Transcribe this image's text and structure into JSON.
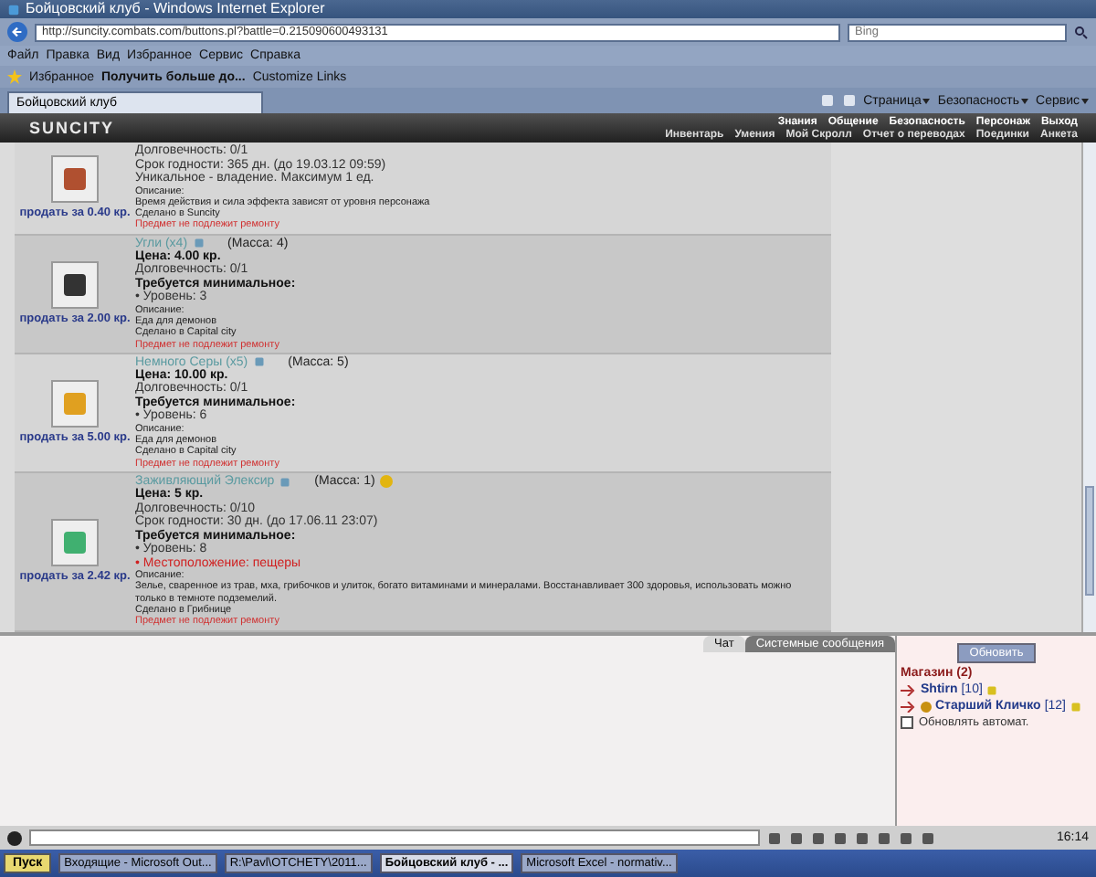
{
  "window": {
    "title": "Бойцовский клуб - Windows Internet Explorer"
  },
  "address_bar": {
    "url": "http://suncity.combats.com/buttons.pl?battle=0.215090600493131",
    "search_placeholder": "Bing"
  },
  "menu": [
    "Файл",
    "Правка",
    "Вид",
    "Избранное",
    "Сервис",
    "Справка"
  ],
  "favorites_bar": {
    "favorites": "Избранное",
    "links": [
      "Получить больше до...",
      "Customize Links"
    ]
  },
  "tabs": [
    {
      "label": "Бойцовский клуб",
      "selected": true
    }
  ],
  "command_bar": [
    "Страница",
    "Безопасность",
    "Сервис"
  ],
  "game": {
    "logo": "SUNCITY",
    "top_nav": [
      "Знания",
      "Общение",
      "Безопасность",
      "Персонаж",
      "Выход"
    ],
    "sub_nav": [
      "Инвентарь",
      "Умения",
      "Мой Скролл",
      "Отчет о переводах",
      "Поединки",
      "Анкета"
    ]
  },
  "items": [
    {
      "sell": "продать за 0.40 кр.",
      "marked": false,
      "lines": [
        {
          "kind": "info",
          "text": "Долговечность: 0/1"
        },
        {
          "kind": "info",
          "text": "Срок годности: 365 дн. (до 19.03.12 09:59)"
        },
        {
          "kind": "info",
          "text": "Уникальное - владение. Максимум 1 ед."
        },
        {
          "kind": "small",
          "text": "Описание:"
        },
        {
          "kind": "small",
          "text": "Время действия и сила эффекта зависят от уровня персонажа"
        },
        {
          "kind": "small",
          "text": "Сделано в Suncity"
        },
        {
          "kind": "warning",
          "text": "Предмет не подлежит ремонту"
        }
      ]
    },
    {
      "name": "Угли (x4)",
      "mass": "(Масса: 4)",
      "sell": "продать за 2.00 кр.",
      "marked": false,
      "lines": [
        {
          "kind": "price",
          "text": "Цена: 4.00 кр."
        },
        {
          "kind": "info",
          "text": "Долговечность: 0/1"
        },
        {
          "kind": "heading",
          "text": "Требуется минимальное:"
        },
        {
          "kind": "info",
          "text": "• Уровень: 3"
        },
        {
          "kind": "small",
          "text": "Описание:"
        },
        {
          "kind": "small",
          "text": "Еда для демонов"
        },
        {
          "kind": "small",
          "text": "Сделано в Capital city"
        },
        {
          "kind": "warning",
          "text": "Предмет не подлежит ремонту"
        }
      ]
    },
    {
      "name": "Немного Серы (x5)",
      "mass": "(Масса: 5)",
      "sell": "продать за 5.00 кр.",
      "marked": false,
      "lines": [
        {
          "kind": "price",
          "text": "Цена: 10.00 кр."
        },
        {
          "kind": "info",
          "text": "Долговечность: 0/1"
        },
        {
          "kind": "heading",
          "text": "Требуется минимальное:"
        },
        {
          "kind": "info",
          "text": "• Уровень: 6"
        },
        {
          "kind": "small",
          "text": "Описание:"
        },
        {
          "kind": "small",
          "text": "Еда для демонов"
        },
        {
          "kind": "small",
          "text": "Сделано в Capital city"
        },
        {
          "kind": "warning",
          "text": "Предмет не подлежит ремонту"
        }
      ]
    },
    {
      "name": "Заживляющий Элексир",
      "mass": "(Масса: 1)",
      "sell": "продать за 2.42 кр.",
      "marked": true,
      "lines": [
        {
          "kind": "price",
          "text": "Цена: 5 кр."
        },
        {
          "kind": "info",
          "text": "Долговечность: 0/10"
        },
        {
          "kind": "info",
          "text": "Срок годности: 30 дн. (до 17.06.11 23:07)"
        },
        {
          "kind": "heading",
          "text": "Требуется минимальное:"
        },
        {
          "kind": "info",
          "text": "• Уровень: 8"
        },
        {
          "kind": "unmet",
          "text": "• Местоположение: пещеры"
        },
        {
          "kind": "small",
          "text": "Описание:"
        },
        {
          "kind": "small",
          "text": "Зелье, сваренное из трав, мха, грибочков и улиток, богато витаминами и минералами. Восстанавливает 300 здоровья, использовать можно только в темноте подземелий."
        },
        {
          "kind": "small",
          "text": "Сделано в Грибнице"
        },
        {
          "kind": "warning",
          "text": "Предмет не подлежит ремонту"
        }
      ]
    }
  ],
  "chat": {
    "tabs": [
      {
        "label": "Чат",
        "selected": true
      },
      {
        "label": "Системные сообщения",
        "selected": false
      }
    ],
    "refresh_button": "Обновить",
    "room": "Магазин (2)",
    "users": [
      {
        "name": "Shtirn",
        "level": "[10]",
        "marked": false
      },
      {
        "name": "Старший Кличко",
        "level": "[12]",
        "marked": true
      }
    ],
    "auto_refresh": {
      "label": "Обновлять автомат.",
      "checked": false
    }
  },
  "taskbar": {
    "start": "Пуск",
    "tasks": [
      {
        "label": "Входящие - Microsoft Out...",
        "selected": false
      },
      {
        "label": "R:\\Pavl\\OTCHETY\\2011...",
        "selected": false
      },
      {
        "label": "Бойцовский клуб - ...",
        "selected": true
      },
      {
        "label": "Microsoft Excel - normativ...",
        "selected": false
      }
    ],
    "clock": "16:14"
  }
}
